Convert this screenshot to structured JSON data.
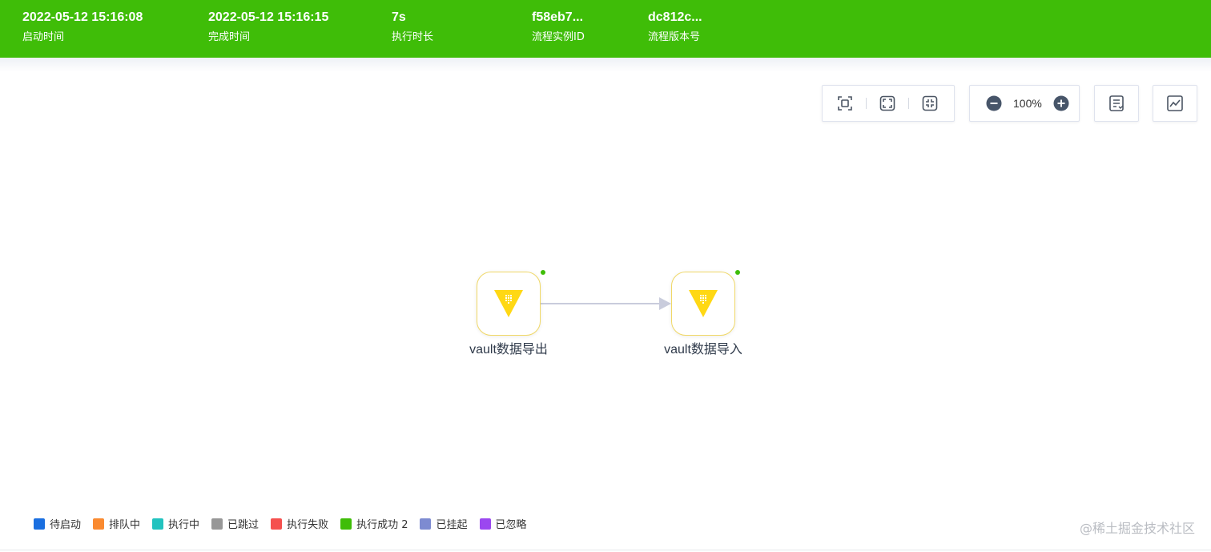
{
  "header": {
    "stats": [
      {
        "value": "2022-05-12 15:16:08",
        "label": "启动时间"
      },
      {
        "value": "2022-05-12 15:16:15",
        "label": "完成时间"
      },
      {
        "value": "7s",
        "label": "执行时长"
      },
      {
        "value": "f58eb7...",
        "label": "流程实例ID"
      },
      {
        "value": "dc812c...",
        "label": "流程版本号"
      }
    ],
    "bg_color": "#3fbd08"
  },
  "toolbar": {
    "zoom_level": "100%",
    "icons": [
      "fit-view-icon",
      "fullscreen-icon",
      "reset-position-icon",
      "zoom-out-icon",
      "zoom-in-icon",
      "node-list-icon",
      "chart-icon"
    ]
  },
  "canvas": {
    "nodes": [
      {
        "label": "vault数据导出",
        "icon": "vault-logo",
        "status": "success"
      },
      {
        "label": "vault数据导入",
        "icon": "vault-logo",
        "status": "success"
      }
    ],
    "edges": [
      {
        "from": 0,
        "to": 1
      }
    ]
  },
  "legend": {
    "items": [
      {
        "label": "待启动",
        "color": "#1a6fe0"
      },
      {
        "label": "排队中",
        "color": "#fa8a30"
      },
      {
        "label": "执行中",
        "color": "#22c3bf"
      },
      {
        "label": "已跳过",
        "color": "#979797"
      },
      {
        "label": "执行失败",
        "color": "#f5504e"
      },
      {
        "label": "执行成功 2",
        "color": "#3fbd08"
      },
      {
        "label": "已挂起",
        "color": "#7d8bd1"
      },
      {
        "label": "已忽略",
        "color": "#9b47f0"
      }
    ]
  },
  "watermark": "@稀土掘金技术社区"
}
